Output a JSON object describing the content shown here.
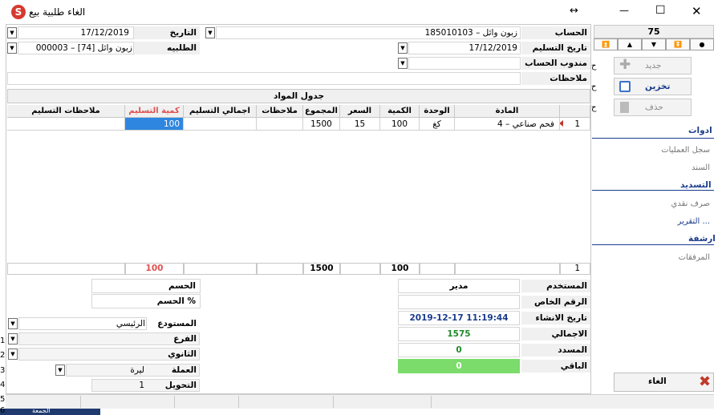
{
  "window": {
    "title": "الغاء طلبية بيع",
    "move_glyph": "↔",
    "minimize": "—",
    "maximize": "☐",
    "close": "✕"
  },
  "header": {
    "account_label": "الحساب",
    "account_value": "185010103 – زبون وائل",
    "date_label": "التاريخ",
    "date_value": "17/12/2019",
    "delivery_date_label": "تاريخ التسليم",
    "delivery_date_value": "17/12/2019",
    "order_label": "الطلبيه",
    "order_value": "000003 – زبون وائل [74]",
    "rep_label": "مندوب الحساب",
    "notes_label": "ملاحظات"
  },
  "nav": {
    "record_number": "75",
    "buttons": [
      "⏫",
      "▲",
      "▼",
      "⏬",
      "●"
    ]
  },
  "grid": {
    "title": "جدول المواد",
    "columns": [
      "المادة",
      "الوحدة",
      "الكمية",
      "السعر",
      "المجموع",
      "ملاحظات",
      "اجمالي التسليم",
      "كمية التسليم",
      "ملاحظات التسليم"
    ],
    "rows": [
      {
        "num": "1",
        "item": "4 – فحم صناعي",
        "unit": "كغ",
        "qty": "100",
        "price": "15",
        "total": "1500",
        "notes": "",
        "delivered_total": "",
        "delivered_qty": "100",
        "delivery_notes": ""
      }
    ],
    "footer": {
      "count": "1",
      "qty_total": "100",
      "sum_total": "1500",
      "delivered_qty_total": "100"
    }
  },
  "summary": {
    "user_label": "المستخدم",
    "user_value": "مدير",
    "private_no_label": "الرقم الخاص",
    "private_no_value": "",
    "created_label": "تاريخ الانشاء",
    "created_value": "2019-12-17 11:19:44",
    "total_label": "الاجمالي",
    "total_value": "1575",
    "paid_label": "المسدد",
    "paid_value": "0",
    "remaining_label": "الباقي",
    "remaining_value": "0"
  },
  "discount": {
    "discount_label": "الحسم",
    "discount_pct_label": "الحسم %"
  },
  "lower": {
    "warehouse_label": "المستودع",
    "warehouse_value": "الرئيسي",
    "branch_label": "الفرع",
    "secondary_label": "الثانوي",
    "currency_label": "العملة",
    "currency_value": "ليرة",
    "conversion_label": "التحويل",
    "conversion_value": "1"
  },
  "sidebar": {
    "new_label": "جديد",
    "save_label": "تخزين",
    "delete_label": "حذف",
    "tools_header": "ادوات",
    "ops_log": "سجل العمليات",
    "voucher": "السند",
    "payment_header": "التسديد",
    "cash_out": "صرف نقدي",
    "report": "التقرير ...",
    "archive_header": "ارشفة",
    "attachments": "المرفقات",
    "cancel_label": "الغاء"
  },
  "edge_numbers": [
    "1",
    "2",
    "3",
    "4",
    "5",
    "6"
  ],
  "edge_letters": [
    "ح",
    "ح",
    "ح"
  ],
  "taskbar": {
    "label": "الجمعة"
  },
  "colors": {
    "accent_red": "#c0392b",
    "delivered_header": "#e05050",
    "selected_cell": "#2f86e0",
    "remaining_bg": "#7bdc6b",
    "total_green": "#1f8a2a",
    "link_blue": "#1a3c8c"
  }
}
